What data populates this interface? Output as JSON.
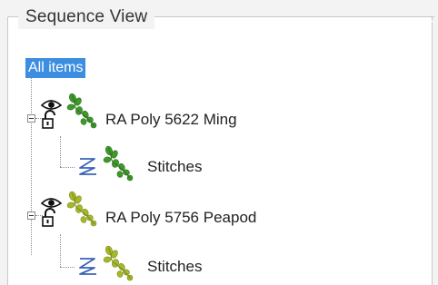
{
  "panel": {
    "title": "Sequence View"
  },
  "tree": {
    "root_label": "All items",
    "designs": [
      {
        "label": "RA Poly 5622 Ming",
        "child_label": "Stitches",
        "thread_color": "#3f9a2a",
        "thread_color_dark": "#2d6f1d"
      },
      {
        "label": "RA Poly 5756 Peapod",
        "child_label": "Stitches",
        "thread_color": "#a7b82b",
        "thread_color_dark": "#7b8a19"
      }
    ]
  },
  "icons": {
    "visibility": "eye-icon",
    "lock": "lock-icon",
    "thread": "vine-thread-icon",
    "stitch_type": "zigzag-stitch-icon",
    "expander": "tree-collapse-icon"
  },
  "colors": {
    "selection": "#3b8ee0",
    "zigzag": "#3a63b8"
  }
}
